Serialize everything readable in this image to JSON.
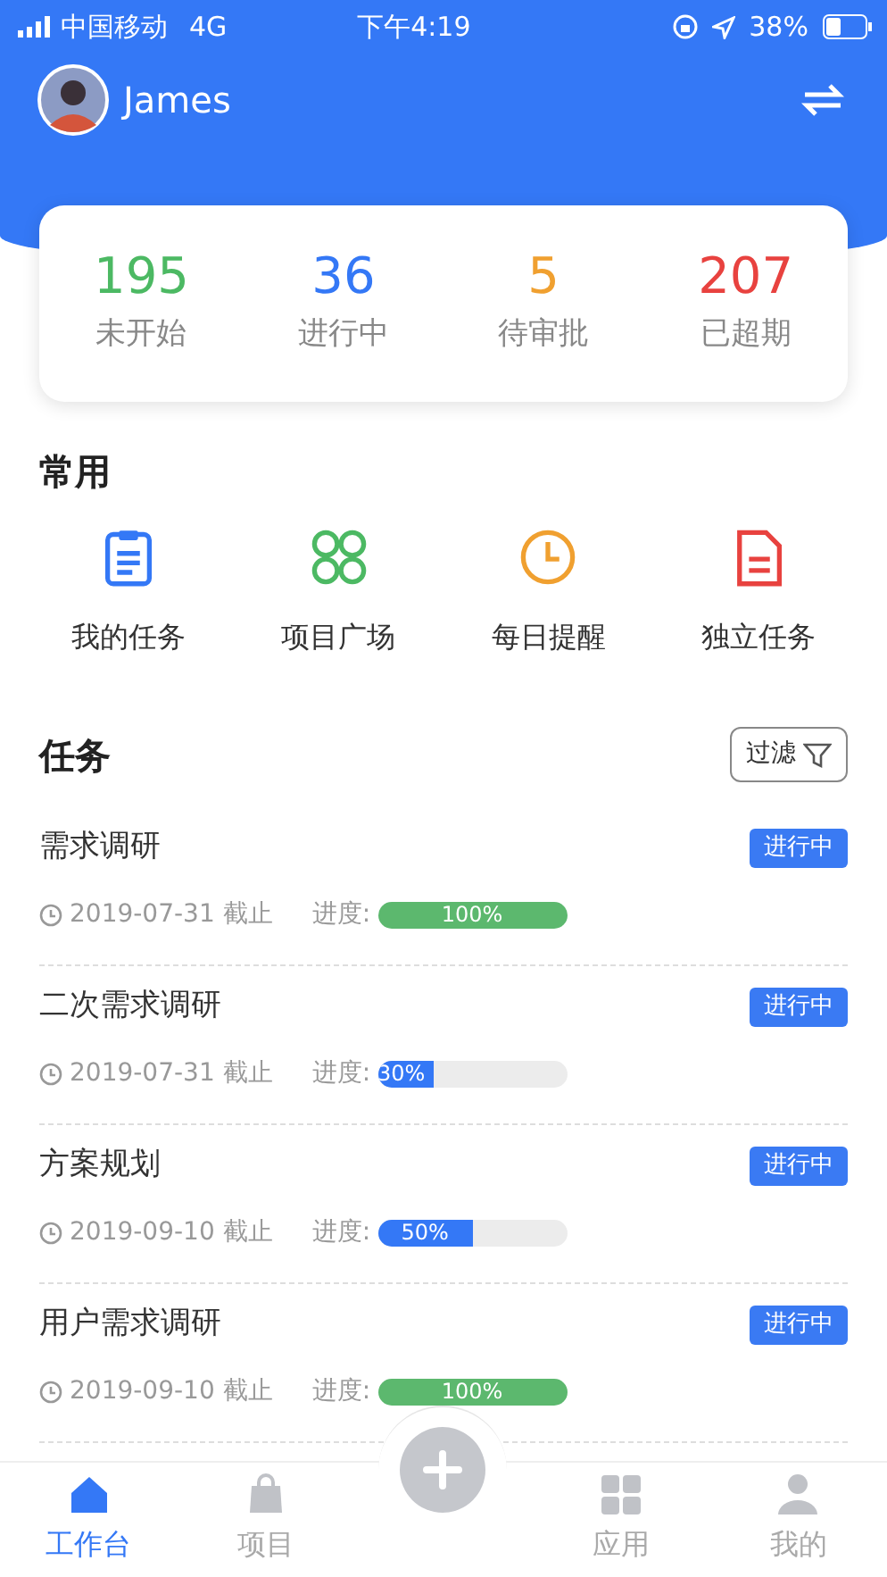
{
  "status_bar": {
    "carrier": "中国移动",
    "network": "4G",
    "time": "下午4:19",
    "battery": "38%"
  },
  "header": {
    "user": "James"
  },
  "stats": [
    {
      "value": "195",
      "label": "未开始",
      "color": "#4cb963"
    },
    {
      "value": "36",
      "label": "进行中",
      "color": "#3478f6"
    },
    {
      "value": "5",
      "label": "待审批",
      "color": "#f0a030"
    },
    {
      "value": "207",
      "label": "已超期",
      "color": "#e8423f"
    }
  ],
  "shortcuts": {
    "title": "常用",
    "items": [
      {
        "label": "我的任务",
        "kind": "clipboard",
        "color": "#3478f6"
      },
      {
        "label": "项目广场",
        "kind": "grid",
        "color": "#4cb963"
      },
      {
        "label": "每日提醒",
        "kind": "clock",
        "color": "#f0a030"
      },
      {
        "label": "独立任务",
        "kind": "file",
        "color": "#e8423f"
      }
    ]
  },
  "tasks": {
    "title": "任务",
    "filter": "过滤",
    "items": [
      {
        "name": "需求调研",
        "status": "进行中",
        "deadline": "2019-07-31 截止",
        "progress_label": "进度:",
        "percent": "100%",
        "level": 1,
        "color": "#5cb86e"
      },
      {
        "name": "二次需求调研",
        "status": "进行中",
        "deadline": "2019-07-31 截止",
        "progress_label": "进度:",
        "percent": "30%",
        "level": 0.3,
        "color": "#3478f6"
      },
      {
        "name": "方案规划",
        "status": "进行中",
        "deadline": "2019-09-10 截止",
        "progress_label": "进度:",
        "percent": "50%",
        "level": 0.5,
        "color": "#3478f6"
      },
      {
        "name": "用户需求调研",
        "status": "进行中",
        "deadline": "2019-09-10 截止",
        "progress_label": "进度:",
        "percent": "100%",
        "level": 1,
        "color": "#5cb86e"
      }
    ]
  },
  "tab_bar": [
    {
      "label": "工作台",
      "kind": "home",
      "selected": true
    },
    {
      "label": "项目",
      "kind": "bag",
      "selected": false
    },
    {
      "kind": "add"
    },
    {
      "label": "应用",
      "kind": "apps",
      "selected": false
    },
    {
      "label": "我的",
      "kind": "user",
      "selected": false
    }
  ]
}
